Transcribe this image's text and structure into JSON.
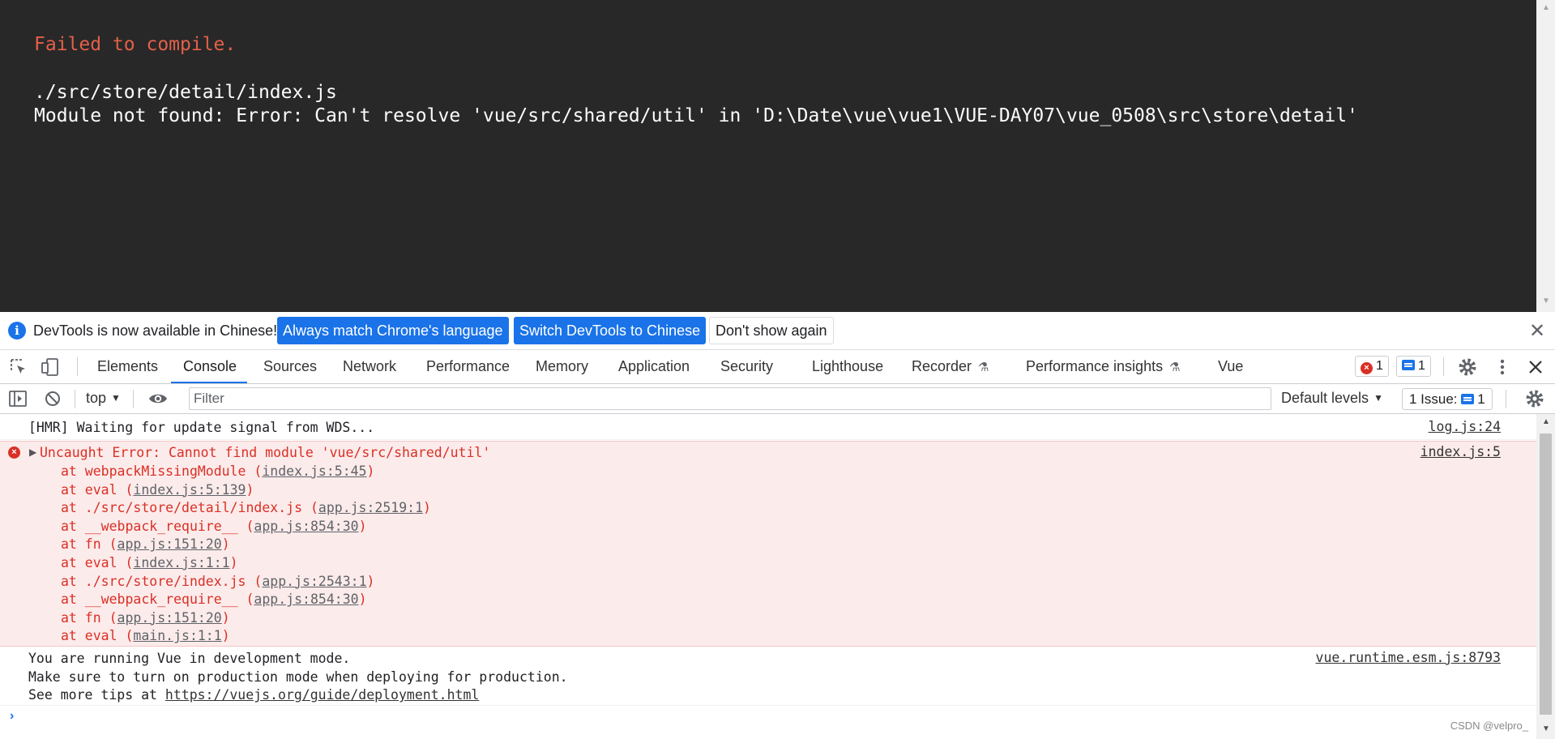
{
  "overlay": {
    "title": "Failed to compile.",
    "file": "./src/store/detail/index.js",
    "message": "Module not found: Error: Can't resolve 'vue/src/shared/util' in 'D:\\Date\\vue\\vue1\\VUE-DAY07\\vue_0508\\src\\store\\detail'"
  },
  "infobar": {
    "text": "DevTools is now available in Chinese!",
    "btn_match": "Always match Chrome's language",
    "btn_switch": "Switch DevTools to Chinese",
    "btn_dismiss": "Don't show again",
    "close": "✕"
  },
  "tabs": {
    "elements": "Elements",
    "console": "Console",
    "sources": "Sources",
    "network": "Network",
    "performance": "Performance",
    "memory": "Memory",
    "application": "Application",
    "security": "Security",
    "lighthouse": "Lighthouse",
    "recorder": "Recorder",
    "perf_insights": "Performance insights",
    "vue": "Vue",
    "errors_count": "1",
    "messages_count": "1"
  },
  "toolbar": {
    "context": "top",
    "filter_placeholder": "Filter",
    "levels": "Default levels",
    "issues_label": "1 Issue:",
    "issues_count": "1"
  },
  "messages": {
    "hmr": {
      "text": "[HMR] Waiting for update signal from WDS...",
      "source": "log.js:24"
    },
    "error": {
      "head": "Uncaught Error: Cannot find module 'vue/src/shared/util'",
      "source": "index.js:5",
      "stack": [
        {
          "fn": "at webpackMissingModule (",
          "loc": "index.js:5:45",
          "end": ")"
        },
        {
          "fn": "at eval (",
          "loc": "index.js:5:139",
          "end": ")"
        },
        {
          "fn": "at ./src/store/detail/index.js (",
          "loc": "app.js:2519:1",
          "end": ")"
        },
        {
          "fn": "at __webpack_require__ (",
          "loc": "app.js:854:30",
          "end": ")"
        },
        {
          "fn": "at fn (",
          "loc": "app.js:151:20",
          "end": ")"
        },
        {
          "fn": "at eval (",
          "loc": "index.js:1:1",
          "end": ")"
        },
        {
          "fn": "at ./src/store/index.js (",
          "loc": "app.js:2543:1",
          "end": ")"
        },
        {
          "fn": "at __webpack_require__ (",
          "loc": "app.js:854:30",
          "end": ")"
        },
        {
          "fn": "at fn (",
          "loc": "app.js:151:20",
          "end": ")"
        },
        {
          "fn": "at eval (",
          "loc": "main.js:1:1",
          "end": ")"
        }
      ]
    },
    "vue": {
      "line1": "You are running Vue in development mode.",
      "line2": "Make sure to turn on production mode when deploying for production.",
      "line3_prefix": "See more tips at ",
      "line3_link": "https://vuejs.org/guide/deployment.html",
      "source": "vue.runtime.esm.js:8793"
    }
  },
  "watermark": "CSDN @velpro_",
  "colors": {
    "accent": "#1a73e8",
    "error_text": "#d93025",
    "error_bg": "#fcebeb",
    "overlay_bg": "#282828",
    "overlay_title": "#e36049"
  }
}
